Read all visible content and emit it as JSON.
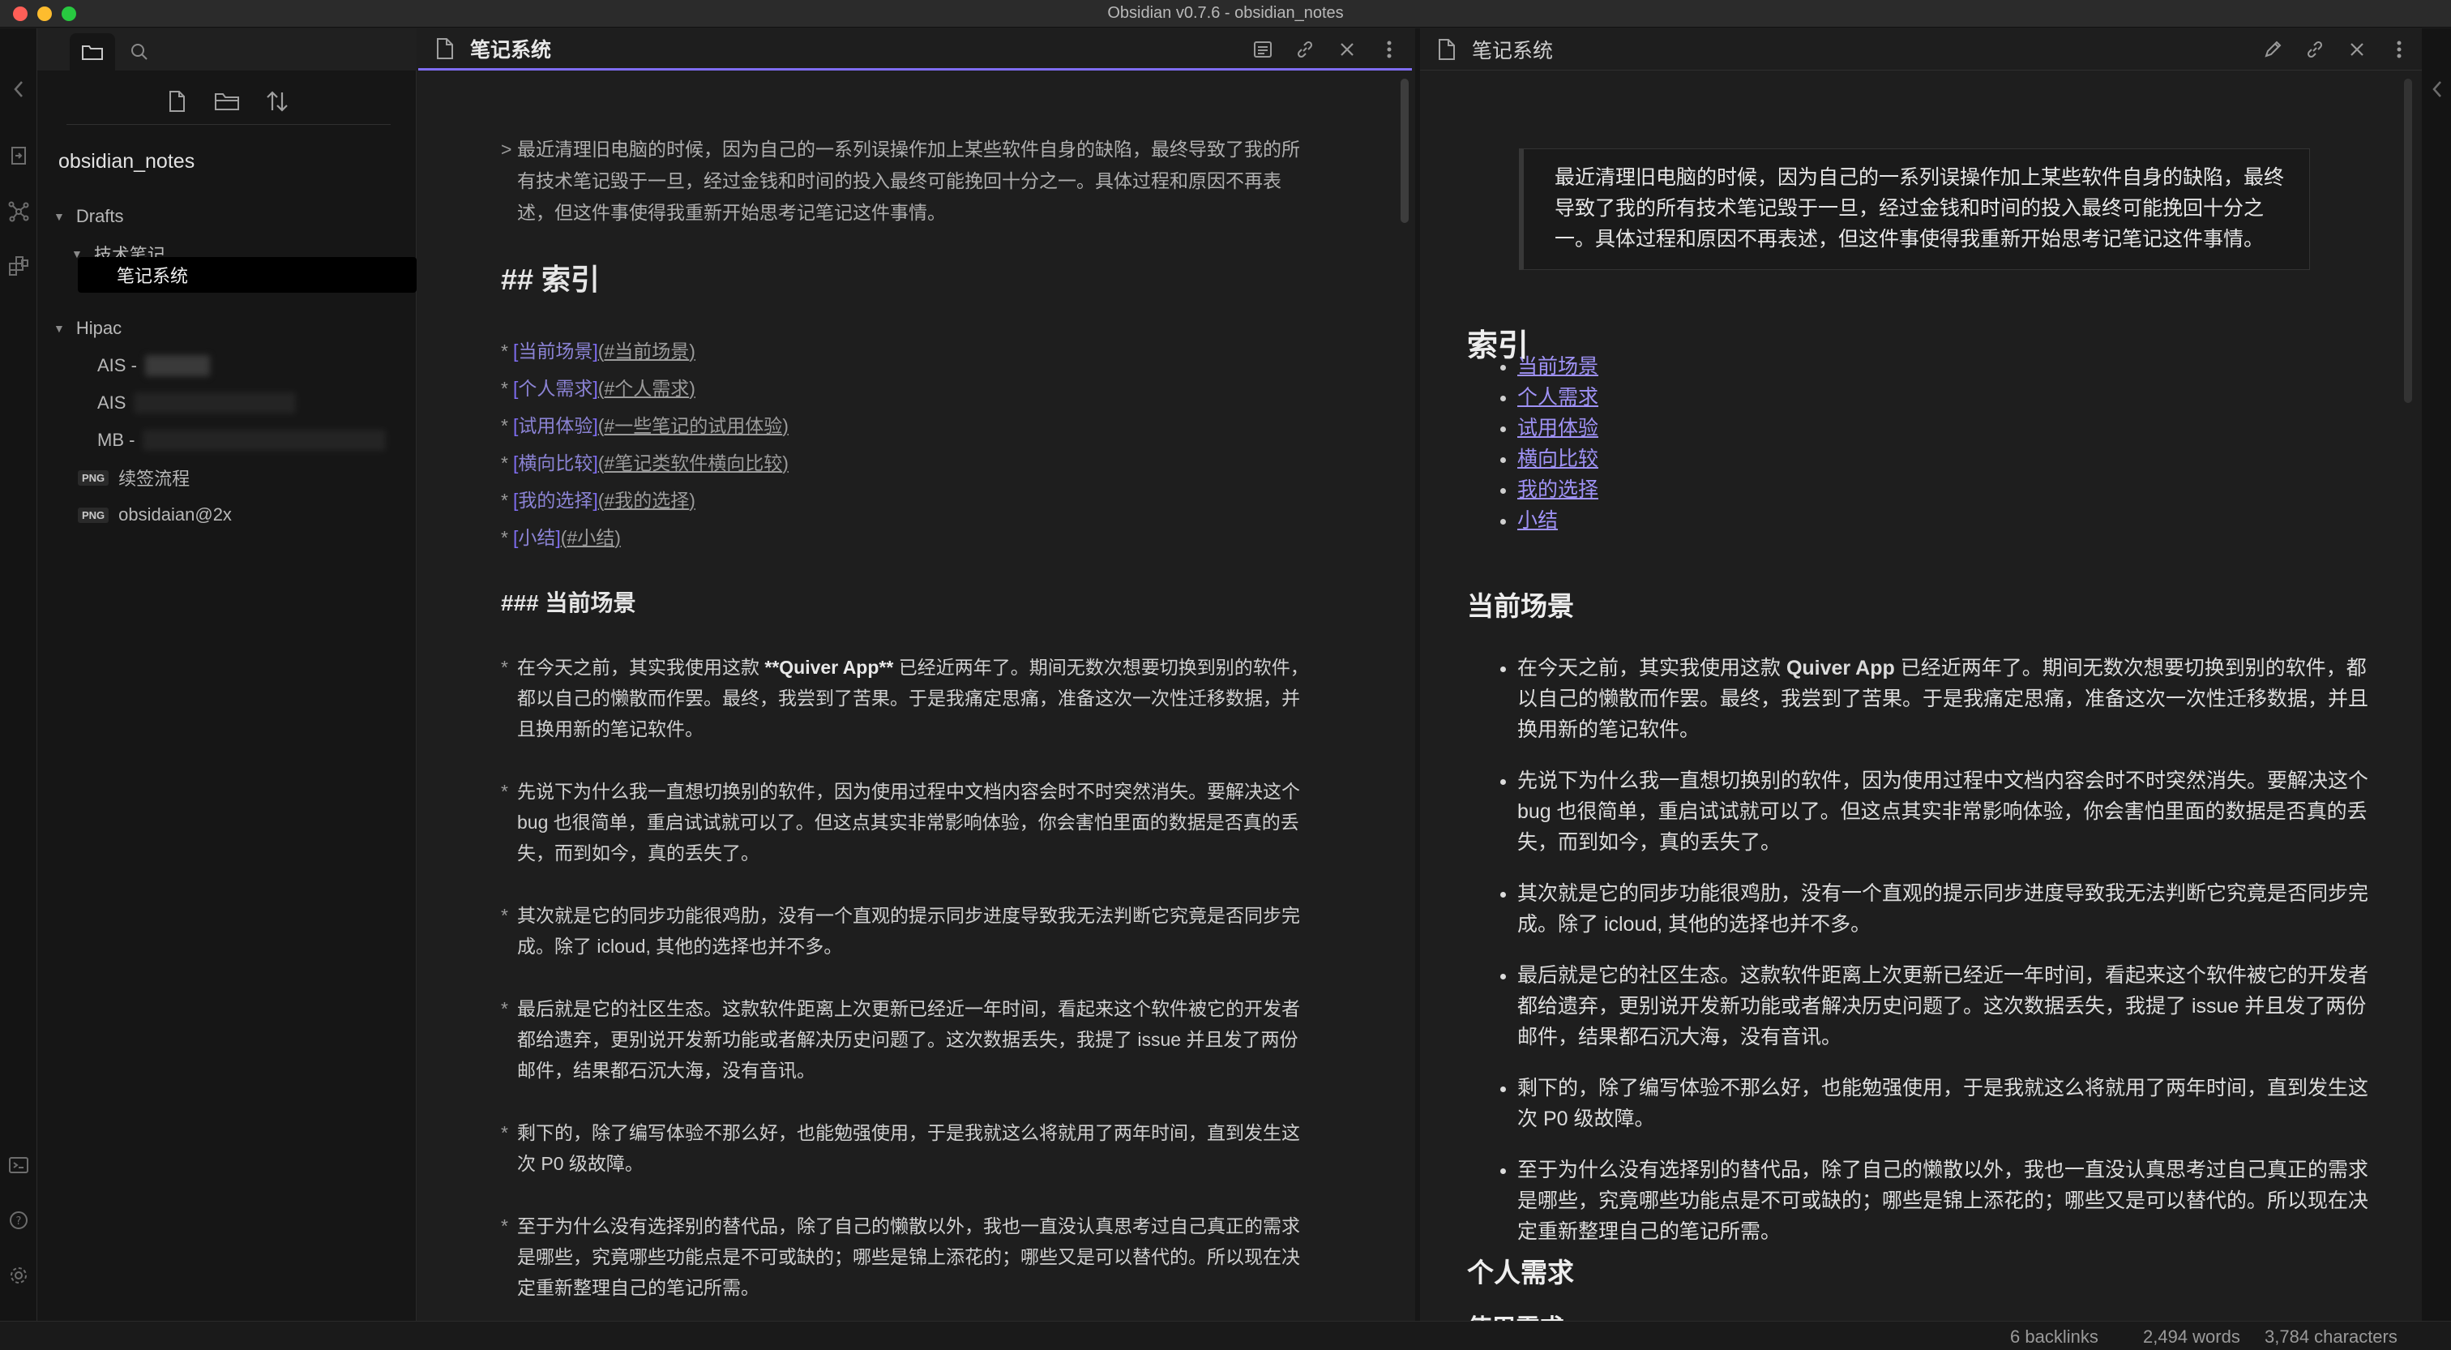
{
  "window": {
    "title": "Obsidian v0.7.6 - obsidian_notes"
  },
  "sidebar": {
    "vault_name": "obsidian_notes",
    "tree": [
      {
        "label": "Drafts",
        "type": "folder",
        "expanded": true
      },
      {
        "label": "技术笔记",
        "type": "folder",
        "expanded": true
      },
      {
        "label": "笔记系统",
        "type": "file",
        "selected": true
      },
      {
        "label": "Hipac",
        "type": "folder",
        "expanded": true
      },
      {
        "label": "AIS -",
        "type": "file"
      },
      {
        "label": "AIS",
        "type": "file"
      },
      {
        "label": "MB -",
        "type": "file"
      },
      {
        "label": "续签流程",
        "type": "png",
        "badge": "PNG"
      },
      {
        "label": "obsidaian@2x",
        "type": "png",
        "badge": "PNG"
      }
    ]
  },
  "editor": {
    "title": "笔记系统",
    "quote": "最近清理旧电脑的时候，因为自己的一系列误操作加上某些软件自身的缺陷，最终导致了我的所有技术笔记毁于一旦，经过金钱和时间的投入最终可能挽回十分之一。具体过程和原因不再表述，但这件事使得我重新开始思考记笔记这件事情。",
    "h2": "## 索引",
    "toc": [
      {
        "text": "当前场景",
        "target": "#当前场景"
      },
      {
        "text": "个人需求",
        "target": "#个人需求"
      },
      {
        "text": "试用体验",
        "target": "#一些笔记的试用体验"
      },
      {
        "text": "横向比较",
        "target": "#笔记类软件横向比较"
      },
      {
        "text": "我的选择",
        "target": "#我的选择"
      },
      {
        "text": "小结",
        "target": "#小结"
      }
    ],
    "h3": "### 当前场景",
    "paragraphs": {
      "p1_pre": "在今天之前，其实我使用这款 ",
      "p1_bold": "**Quiver App**",
      "p1_post": " 已经近两年了。期间无数次想要切换到别的软件，都以自己的懒散而作罢。最终，我尝到了苦果。于是我痛定思痛，准备这次一次性迁移数据，并且换用新的笔记软件。",
      "p2": "先说下为什么我一直想切换别的软件，因为使用过程中文档内容会时不时突然消失。要解决这个 bug 也很简单，重启试试就可以了。但这点其实非常影响体验，你会害怕里面的数据是否真的丢失，而到如今，真的丢失了。",
      "p3": "其次就是它的同步功能很鸡肋，没有一个直观的提示同步进度导致我无法判断它究竟是否同步完成。除了 icloud, 其他的选择也并不多。",
      "p4": "最后就是它的社区生态。这款软件距离上次更新已经近一年时间，看起来这个软件被它的开发者都给遗弃，更别说开发新功能或者解决历史问题了。这次数据丢失，我提了 issue 并且发了两份邮件，结果都石沉大海，没有音讯。",
      "p5": "剩下的，除了编写体验不那么好，也能勉强使用，于是我就这么将就用了两年时间，直到发生这次 P0 级故障。",
      "p6": "至于为什么没有选择别的替代品，除了自己的懒散以外，我也一直没认真思考过自己真正的需求是哪些，究竟哪些功能点是不可或缺的；哪些是锦上添花的；哪些又是可以替代的。所以现在决定重新整理自己的笔记所需。"
    }
  },
  "preview": {
    "title": "笔记系统",
    "quote": "最近清理旧电脑的时候，因为自己的一系列误操作加上某些软件自身的缺陷，最终导致了我的所有技术笔记毁于一旦，经过金钱和时间的投入最终可能挽回十分之一。具体过程和原因不再表述，但这件事使得我重新开始思考记笔记这件事情。",
    "h_index": "索引",
    "links": [
      "当前场景",
      "个人需求",
      "试用体验",
      "横向比较",
      "我的选择",
      "小结"
    ],
    "h_current": "当前场景",
    "items": {
      "i1_pre": "在今天之前，其实我使用这款 ",
      "i1_bold": "Quiver App",
      "i1_post": " 已经近两年了。期间无数次想要切换到别的软件，都以自己的懒散而作罢。最终，我尝到了苦果。于是我痛定思痛，准备这次一次性迁移数据，并且换用新的笔记软件。",
      "i2": "先说下为什么我一直想切换别的软件，因为使用过程中文档内容会时不时突然消失。要解决这个 bug 也很简单，重启试试就可以了。但这点其实非常影响体验，你会害怕里面的数据是否真的丢失，而到如今，真的丢失了。",
      "i3": "其次就是它的同步功能很鸡肋，没有一个直观的提示同步进度导致我无法判断它究竟是否同步完成。除了 icloud, 其他的选择也并不多。",
      "i4": "最后就是它的社区生态。这款软件距离上次更新已经近一年时间，看起来这个软件被它的开发者都给遗弃，更别说开发新功能或者解决历史问题了。这次数据丢失，我提了 issue 并且发了两份邮件，结果都石沉大海，没有音讯。",
      "i5": "剩下的，除了编写体验不那么好，也能勉强使用，于是我就这么将就用了两年时间，直到发生这次 P0 级故障。",
      "i6": "至于为什么没有选择别的替代品，除了自己的懒散以外，我也一直没认真思考过自己真正的需求是哪些，究竟哪些功能点是不可或缺的；哪些是锦上添花的；哪些又是可以替代的。所以现在决定重新整理自己的笔记所需。"
    },
    "h_personal": "个人需求",
    "h_usage": "使用需求"
  },
  "status": {
    "backlinks": "6 backlinks",
    "words": "2,494 words",
    "characters": "3,784 characters"
  },
  "colors": {
    "accent": "#7f6df2",
    "link": "#9f92f5",
    "background": "#1e1e1e",
    "sidebar": "#161616"
  },
  "icons": {
    "ribbon_left": [
      "collapse-left-icon",
      "open-vault-icon",
      "graph-view-icon",
      "plugins-icon",
      "command-palette-icon",
      "help-icon",
      "settings-icon"
    ],
    "explorer": [
      "new-note-icon",
      "new-folder-icon",
      "sort-icon"
    ],
    "editor_header": [
      "preview-toggle-icon",
      "link-icon",
      "close-icon",
      "more-icon"
    ],
    "preview_header": [
      "edit-icon",
      "link-icon",
      "close-icon",
      "more-icon"
    ]
  }
}
